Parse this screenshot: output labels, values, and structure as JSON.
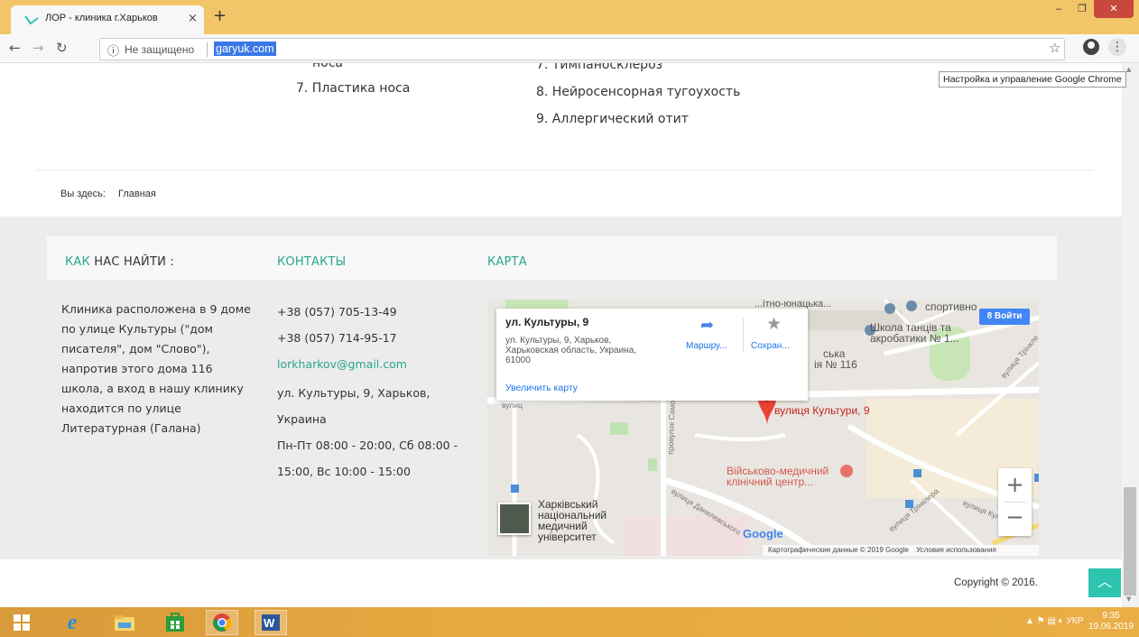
{
  "browser": {
    "tab_title": "ЛОР - клиника г.Харьков",
    "tab_close": "×",
    "new_tab": "+",
    "url_insecure": "Не защищено",
    "url": "garyuk.com",
    "tooltip": "Настройка и управление Google Chrome",
    "accent_color": "#f2c668"
  },
  "content": {
    "left_list": [
      "носа",
      "7. Пластика носа"
    ],
    "right_list": [
      "7. Тимпаносклероз",
      "8. Нейросенсорная тугоухость",
      "9. Аллергический отит"
    ],
    "breadcrumb_label": "Вы здесь:",
    "breadcrumb_home": "Главная"
  },
  "footer": {
    "accent_color": "#2aa58e",
    "how_to_find_accent": "КАК",
    "how_to_find_rest": " НАС НАЙТИ :",
    "contacts_title": "КОНТАКТЫ",
    "map_title": "КАРТА",
    "description": "Клиника расположена в 9 доме по улице Культуры (\"дом писателя\", дом \"Слово\"), напротив этого дома 116 школа, а вход в нашу клинику находится по улице Литературная (Галана)",
    "phone1": "+38 (057) 705-13-49",
    "phone2": "+38 (057) 714-95-17",
    "email": "lorkharkov@gmail.com",
    "address": "ул. Культуры, 9, Харьков, Украина",
    "hours": "Пн-Пт 08:00 - 20:00, Сб 08:00 - 15:00, Вс 10:00 - 15:00",
    "copyright": "Copyright © 2016."
  },
  "map": {
    "card_title": "ул. Культуры, 9",
    "card_address": "ул. Культуры, 9, Харьков, Харьковская область, Украина, 61000",
    "enlarge": "Увеличить карту",
    "route": "Маршру...",
    "save": "Сохран...",
    "signin": "Войти",
    "marker_label": "вулиця Культури, 9",
    "label_school_sport": "спортивно",
    "label_dance_school": "Школа танців та акробатики № 1...",
    "label_school_116_a": "ська",
    "label_school_116_b": "ія № 116",
    "label_top": "...ітно-юнацька...",
    "label_hospital": "Військово-медичний клінічний центр...",
    "label_university": "Харківський національний медичний університет",
    "street_samok": "провулок Самок",
    "street_danylevskogo": "вулиця Данилевського",
    "street_kultury": "вулиця Культури",
    "street_trinkler": "вулиця Трінклера",
    "street_trinkl2": "вулиця Трінкле",
    "street_vul": "вулиц",
    "google": "Google",
    "attribution": "Картографические данные © 2019 Google",
    "terms": "Условия использования",
    "zoom_in": "+",
    "zoom_out": "−"
  },
  "taskbar": {
    "lang": "УКР",
    "time": "9:35",
    "date": "19.06.2019"
  }
}
